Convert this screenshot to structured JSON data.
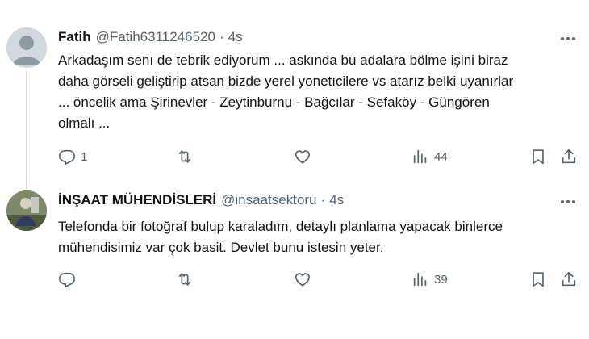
{
  "tweets": [
    {
      "name": "Fatih",
      "handle": "@Fatih6311246520",
      "separator": "·",
      "time": "4s",
      "lines": [
        "Arkadaşım senı de tebrik ediyorum ... askında bu adalara bölme işini biraz",
        "daha görseli geliştirip atsan bizde yerel yonetıcilere vs atarız belki uyanırlar",
        "... öncelik ama Şirinevler - Zeytinburnu - Bağcılar - Sefaköy - Güngören",
        "olmalı ..."
      ],
      "replies": "1",
      "views": "44"
    },
    {
      "name": "İNŞAAT MÜHENDİSLERİ",
      "handle": "@insaatsektoru",
      "separator": "·",
      "time": "4s",
      "lines": [
        "Telefonda bir fotoğraf bulup karaladım, detaylı planlama yapacak binlerce",
        "mühendisimiz var çok basit. Devlet bunu istesin yeter."
      ],
      "replies": "",
      "views": "39"
    }
  ],
  "colors": {
    "text": "#0f1419",
    "secondary": "#536471",
    "thread_line": "#cfd9de"
  },
  "icons": [
    "more-icon",
    "reply-icon",
    "retweet-icon",
    "like-icon",
    "views-icon",
    "bookmark-icon",
    "share-icon"
  ]
}
